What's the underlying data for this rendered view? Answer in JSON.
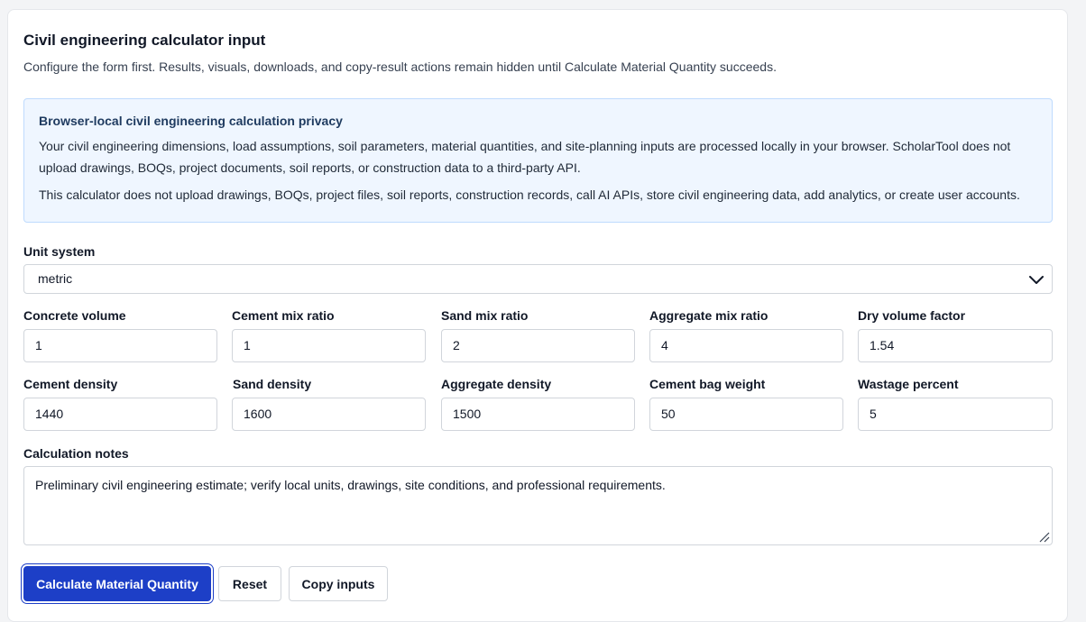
{
  "header": {
    "title": "Civil engineering calculator input",
    "subtitle": "Configure the form first. Results, visuals, downloads, and copy-result actions remain hidden until Calculate Material Quantity succeeds."
  },
  "privacy": {
    "heading": "Browser-local civil engineering calculation privacy",
    "paragraph1": "Your civil engineering dimensions, load assumptions, soil parameters, material quantities, and site-planning inputs are processed locally in your browser. ScholarTool does not upload drawings, BOQs, project documents, soil reports, or construction data to a third-party API.",
    "paragraph2": "This calculator does not upload drawings, BOQs, project files, soil reports, construction records, call AI APIs, store civil engineering data, add analytics, or create user accounts."
  },
  "form": {
    "unit_system": {
      "label": "Unit system",
      "value": "metric"
    },
    "fields_row1": [
      {
        "label": "Concrete volume",
        "value": "1"
      },
      {
        "label": "Cement mix ratio",
        "value": "1"
      },
      {
        "label": "Sand mix ratio",
        "value": "2"
      },
      {
        "label": "Aggregate mix ratio",
        "value": "4"
      },
      {
        "label": "Dry volume factor",
        "value": "1.54"
      }
    ],
    "fields_row2": [
      {
        "label": "Cement density",
        "value": "1440"
      },
      {
        "label": "Sand density",
        "value": "1600"
      },
      {
        "label": "Aggregate density",
        "value": "1500"
      },
      {
        "label": "Cement bag weight",
        "value": "50"
      },
      {
        "label": "Wastage percent",
        "value": "5"
      }
    ],
    "notes": {
      "label": "Calculation notes",
      "value": "Preliminary civil engineering estimate; verify local units, drawings, site conditions, and professional requirements."
    }
  },
  "actions": {
    "calculate": "Calculate Material Quantity",
    "reset": "Reset",
    "copy": "Copy inputs"
  },
  "colors": {
    "primary": "#1d3fc7",
    "privacy_bg": "#eff6ff",
    "privacy_border": "#bfdbfe"
  }
}
